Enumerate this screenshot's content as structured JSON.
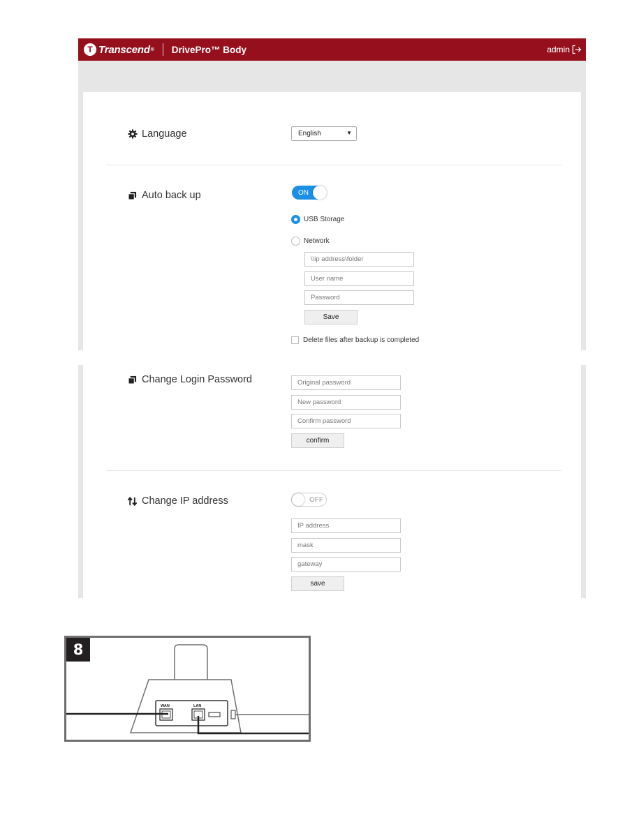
{
  "header": {
    "brand": "Transcend",
    "product": "DrivePro™ Body",
    "user": "admin",
    "logout_icon": "logout-arrow-icon"
  },
  "settings": {
    "language": {
      "title": "Language",
      "icon": "gear-icon",
      "selected": "English"
    },
    "auto_backup": {
      "title": "Auto back up",
      "icon": "copy-icon",
      "toggle": "ON",
      "toggle_state": "on",
      "options": [
        {
          "label": "USB Storage",
          "checked": true
        },
        {
          "label": "Network",
          "checked": false
        }
      ],
      "network_fields": [
        {
          "placeholder": "\\\\ip address\\folder",
          "value": ""
        },
        {
          "placeholder": "User name",
          "value": ""
        },
        {
          "placeholder": "Password",
          "value": ""
        }
      ],
      "save_label": "Save",
      "delete_checkbox_label": "Delete files after backup is completed",
      "delete_checked": false
    },
    "change_password": {
      "title": "Change Login Password",
      "icon": "copy-icon",
      "fields": [
        {
          "placeholder": "Original password",
          "value": ""
        },
        {
          "placeholder": "New password",
          "value": ""
        },
        {
          "placeholder": "Confirm password",
          "value": ""
        }
      ],
      "confirm_label": "confirm"
    },
    "change_ip": {
      "title": "Change IP address",
      "icon": "up-down-arrows-icon",
      "toggle": "OFF",
      "toggle_state": "off",
      "fields": [
        {
          "placeholder": "IP address",
          "value": ""
        },
        {
          "placeholder": "mask",
          "value": ""
        },
        {
          "placeholder": "gateway",
          "value": ""
        }
      ],
      "save_label": "save"
    }
  },
  "diagram": {
    "step_number": "8",
    "port_labels": {
      "wan": "WAN",
      "lan": "LAN"
    }
  }
}
